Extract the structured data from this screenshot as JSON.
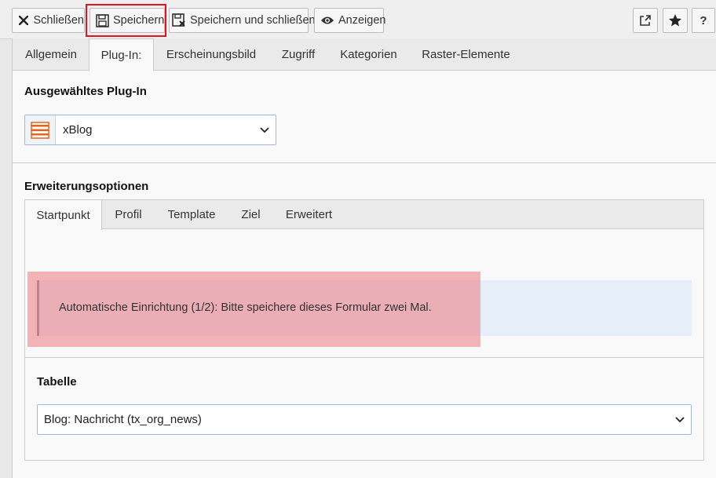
{
  "toolbar": {
    "close_label": "Schließen",
    "save_label": "Speichern",
    "save_close_label": "Speichern und schließen",
    "view_label": "Anzeigen",
    "help_label": "?"
  },
  "tabs": [
    "Allgemein",
    "Plug-In:",
    "Erscheinungsbild",
    "Zugriff",
    "Kategorien",
    "Raster-Elemente"
  ],
  "active_tab": "Plug-In:",
  "plugin": {
    "title": "Ausgewähltes Plug-In",
    "selected": "xBlog"
  },
  "options": {
    "title": "Erweiterungsoptionen",
    "tabs": [
      "Startpunkt",
      "Profil",
      "Template",
      "Ziel",
      "Erweitert"
    ],
    "active_tab": "Startpunkt",
    "notice": "Automatische Einrichtung (1/2): Bitte speichere dieses Formular zwei Mal.",
    "table_label": "Tabelle",
    "table_selected": "Blog: Nachricht (tx_org_news)"
  },
  "colors": {
    "highlight": "#e0141c",
    "plugin_icon": "#e8631a",
    "notice_bg": "#e6eef8"
  }
}
